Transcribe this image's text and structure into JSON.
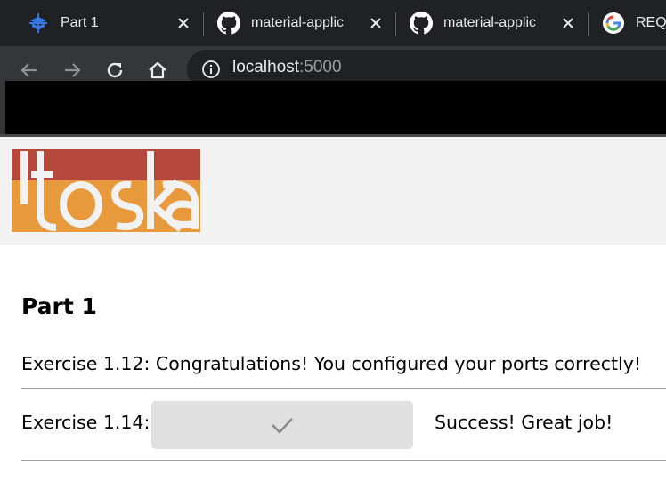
{
  "browser": {
    "tabs": [
      {
        "title": "Part 1",
        "icon": "docusaurus-icon",
        "active": true
      },
      {
        "title": "material-applic",
        "icon": "github-icon",
        "active": false
      },
      {
        "title": "material-applic",
        "icon": "github-icon",
        "active": false
      },
      {
        "title": "REQ",
        "icon": "google-icon",
        "active": false
      }
    ],
    "address": {
      "host": "localhost",
      "port": ":5000"
    }
  },
  "page": {
    "logo": {
      "text": "itoska",
      "colors": {
        "top": "#b5473b",
        "bottom": "#e8993c"
      }
    },
    "title": "Part 1",
    "exercises": [
      {
        "label": "Exercise 1.12: Congratulations! You configured your ports correctly!"
      },
      {
        "label": "Exercise 1.14:",
        "button_icon": "check-icon",
        "status": "Success! Great job!"
      }
    ]
  }
}
